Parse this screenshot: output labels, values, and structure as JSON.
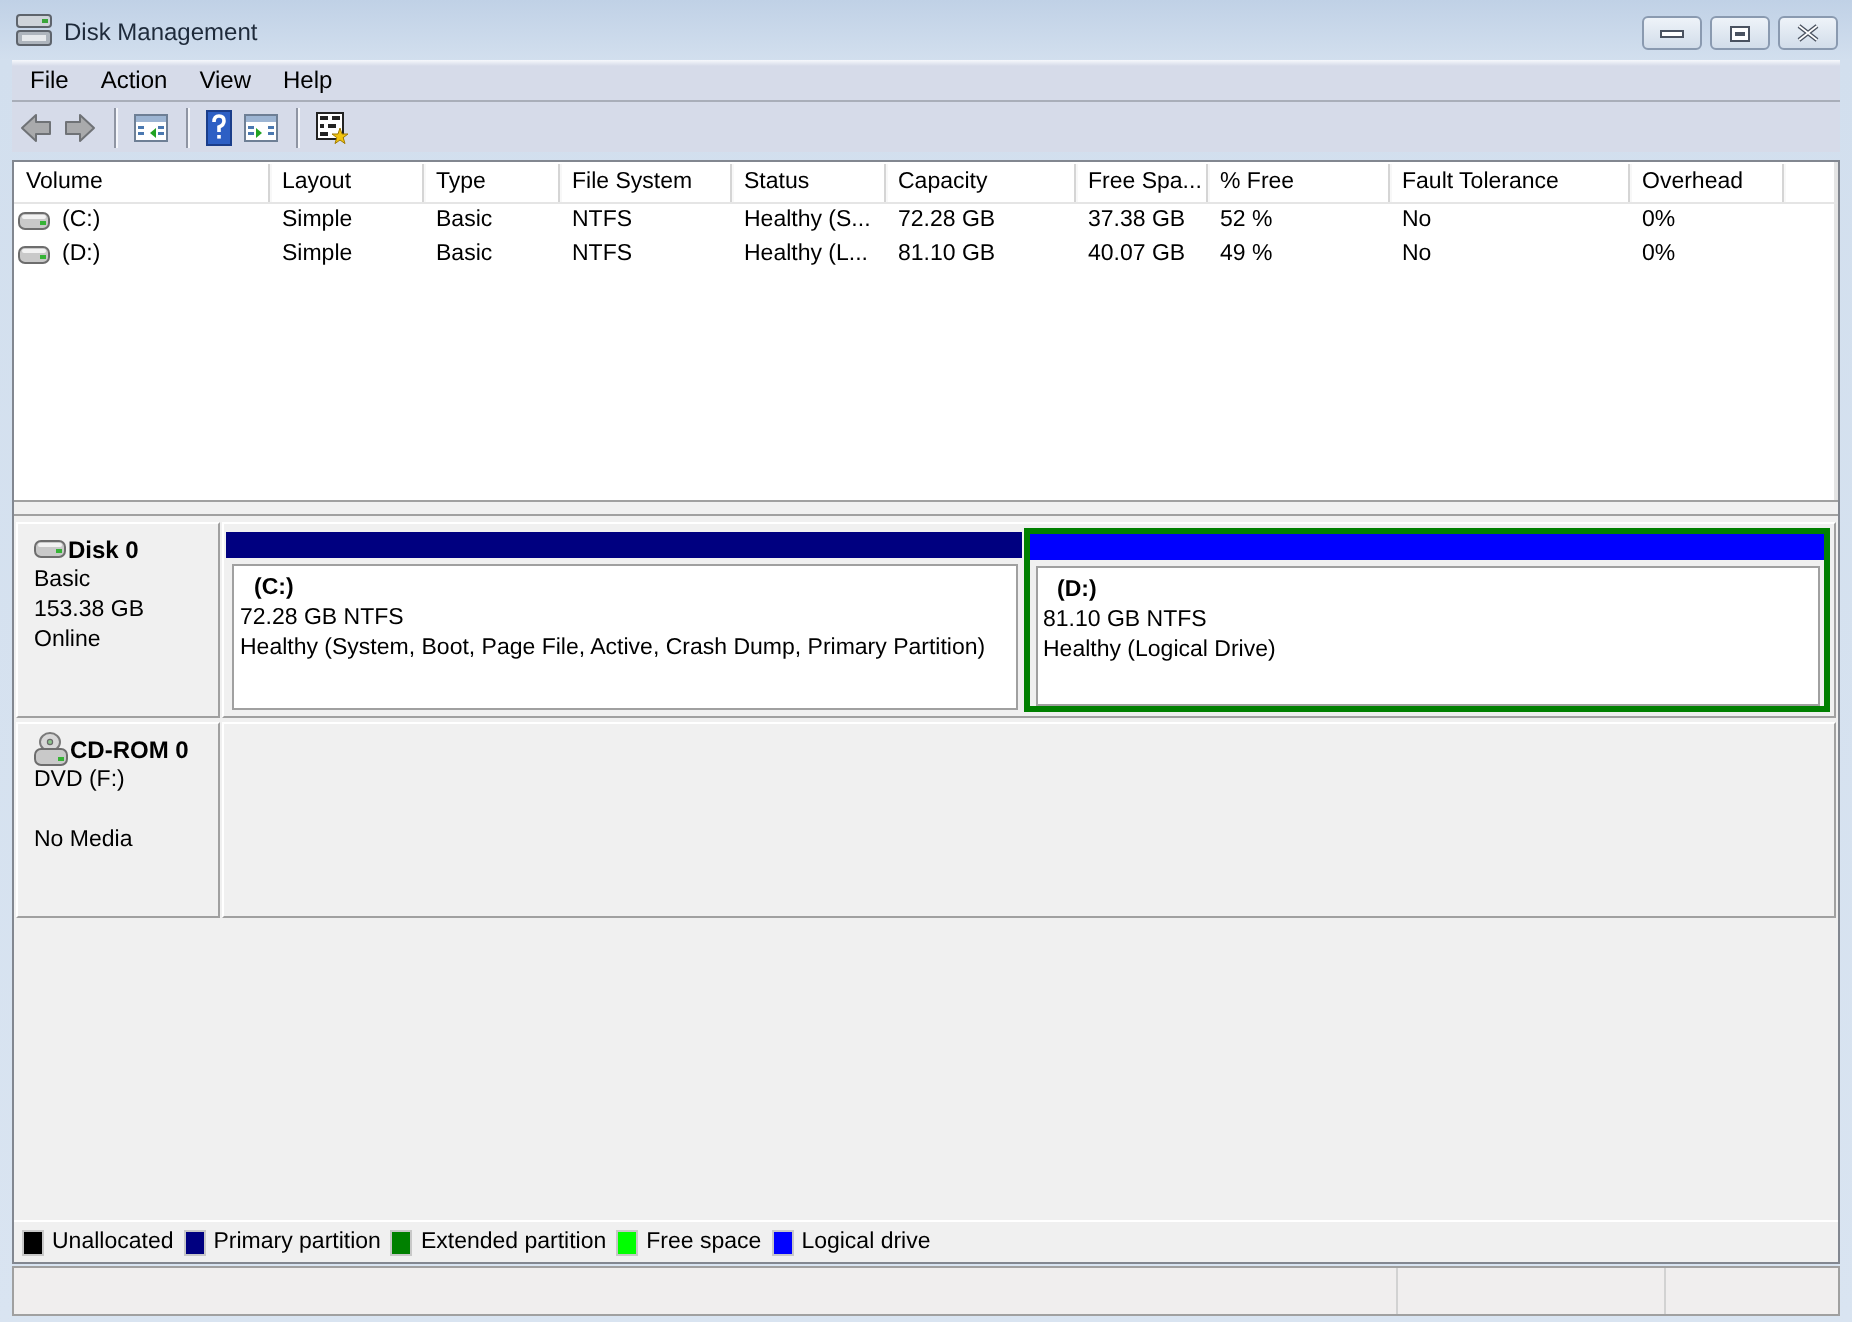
{
  "window": {
    "title": "Disk Management"
  },
  "menu": [
    {
      "label": "File"
    },
    {
      "label": "Action"
    },
    {
      "label": "View"
    },
    {
      "label": "Help"
    }
  ],
  "volumes": {
    "columns": [
      "Volume",
      "Layout",
      "Type",
      "File System",
      "Status",
      "Capacity",
      "Free Spa...",
      "% Free",
      "Fault Tolerance",
      "Overhead"
    ],
    "rows": [
      {
        "selected": false,
        "cells": [
          "(C:)",
          "Simple",
          "Basic",
          "NTFS",
          "Healthy (S...",
          "72.28 GB",
          "37.38 GB",
          "52 %",
          "No",
          "0%"
        ]
      },
      {
        "selected": false,
        "cells": [
          "(D:)",
          "Simple",
          "Basic",
          "NTFS",
          "Healthy (L...",
          "81.10 GB",
          "40.07 GB",
          "49 %",
          "No",
          "0%"
        ]
      }
    ]
  },
  "disks": [
    {
      "kind": "disk",
      "name": "Disk 0",
      "type": "Basic",
      "size": "153.38 GB",
      "status": "Online",
      "partitions": [
        {
          "kind": "volume",
          "name": "(C:)",
          "size": "72.28 GB NTFS",
          "status": "Healthy (System, Boot, Page File, Active, Crash Dump, Primary Partition)",
          "color": "#000080",
          "selected": false
        },
        {
          "kind": "extended",
          "color": "#008000",
          "children": [
            {
              "kind": "volume",
              "name": "(D:)",
              "size": "81.10 GB NTFS",
              "status": "Healthy (Logical Drive)",
              "color": "#0000ff",
              "selected": false
            }
          ]
        }
      ]
    },
    {
      "kind": "cdrom",
      "name": "CD-ROM 0",
      "type": "DVD (F:)",
      "status": "No Media"
    }
  ],
  "legend": [
    {
      "label": "Unallocated",
      "color": "#000000"
    },
    {
      "label": "Primary partition",
      "color": "#000080"
    },
    {
      "label": "Extended partition",
      "color": "#008000"
    },
    {
      "label": "Free space",
      "color": "#00ff00"
    },
    {
      "label": "Logical drive",
      "color": "#0000ff"
    }
  ]
}
